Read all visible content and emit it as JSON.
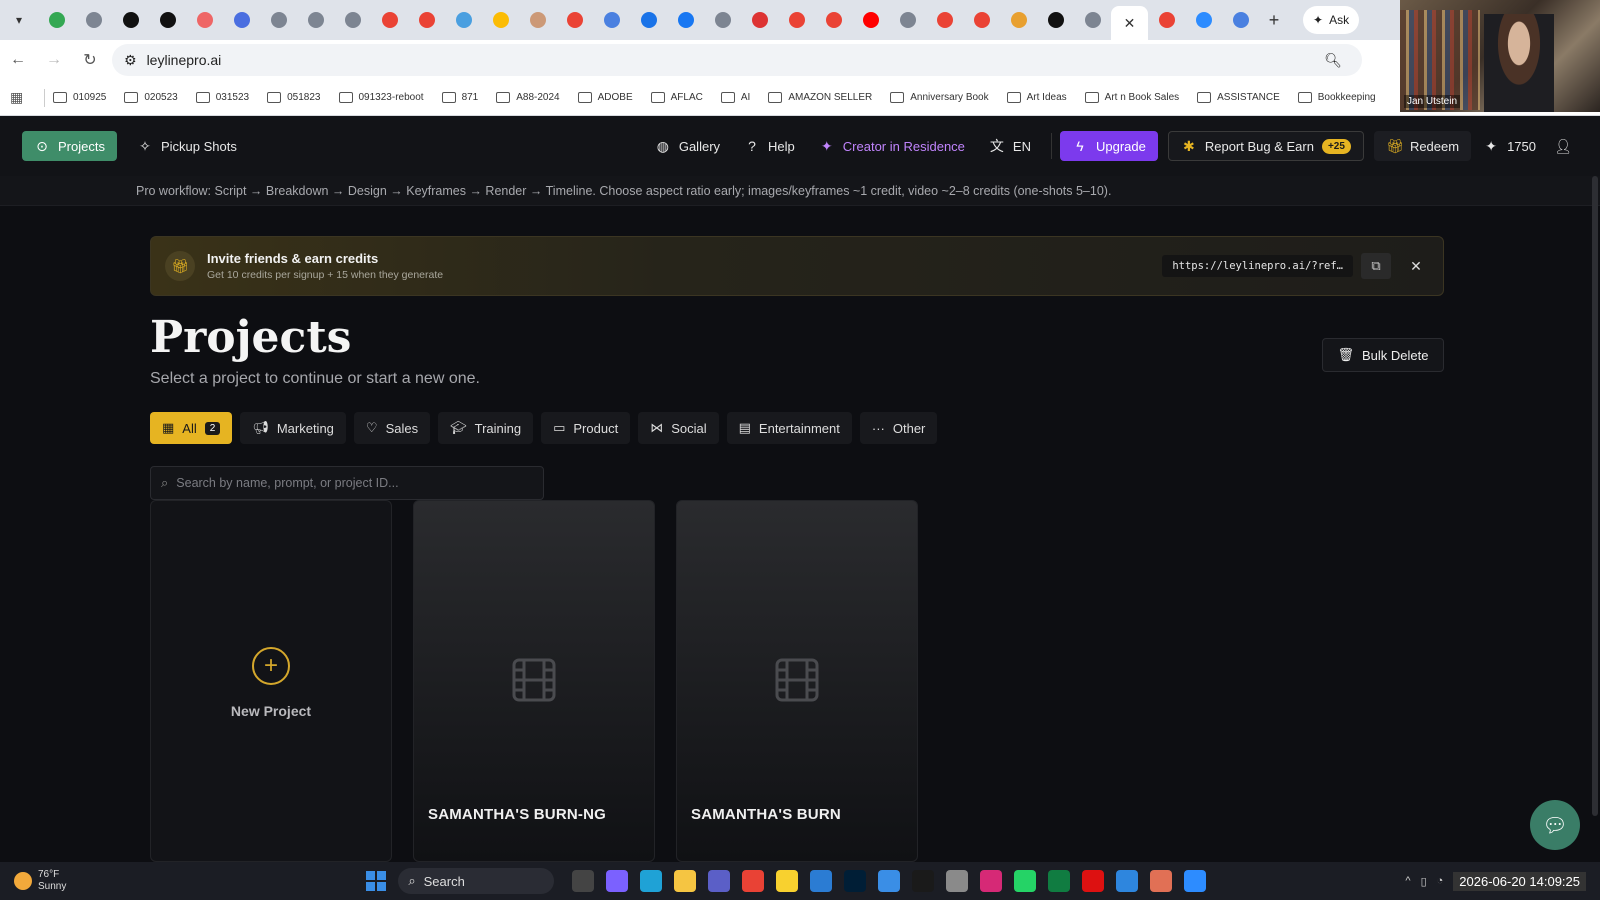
{
  "browser": {
    "active_tab_close": "✕",
    "new_tab": "+",
    "ask_label": "Ask",
    "url": "leylinepro.ai",
    "bookmarks": [
      "010925",
      "020523",
      "031523",
      "051823",
      "091323-reboot",
      "871",
      "A88-2024",
      "ADOBE",
      "AFLAC",
      "AI",
      "AMAZON SELLER",
      "Anniversary Book",
      "Art Ideas",
      "Art n Book Sales",
      "ASSISTANCE",
      "Bookkeeping"
    ]
  },
  "webcam": {
    "name": "Jan Utstein"
  },
  "header": {
    "projects": "Projects",
    "pickup_shots": "Pickup Shots",
    "gallery": "Gallery",
    "help": "Help",
    "creator": "Creator in Residence",
    "language": "EN",
    "upgrade": "Upgrade",
    "report_bug": "Report Bug & Earn",
    "report_bonus": "+25",
    "redeem": "Redeem",
    "credits": "1750"
  },
  "workflow_tip": "Pro workflow: Script → Breakdown → Design → Keyframes → Render → Timeline. Choose aspect ratio early; images/keyframes ~1 credit, video ~2–8 credits (one-shots 5–10).",
  "invite": {
    "title": "Invite friends & earn credits",
    "subtitle": "Get 10 credits per signup + 15 when they generate",
    "link": "https://leylinepro.ai/?ref…"
  },
  "main": {
    "title": "Projects",
    "subtitle": "Select a project to continue or start a new one.",
    "bulk_delete": "Bulk Delete",
    "filters": [
      {
        "label": "All",
        "count": "2"
      },
      {
        "label": "Marketing"
      },
      {
        "label": "Sales"
      },
      {
        "label": "Training"
      },
      {
        "label": "Product"
      },
      {
        "label": "Social"
      },
      {
        "label": "Entertainment"
      },
      {
        "label": "Other"
      }
    ],
    "search_placeholder": "Search by name, prompt, or project ID...",
    "new_project": "New Project",
    "projects": [
      {
        "title": "SAMANTHA'S BURN-NG"
      },
      {
        "title": "SAMANTHA'S BURN"
      }
    ]
  },
  "taskbar": {
    "temp": "76°F",
    "weather": "Sunny",
    "search": "Search",
    "clock": "2026-06-20 14:09:25"
  },
  "colors": {
    "accent_yellow": "#e6b422",
    "projects_green": "#3f8d69",
    "upgrade_purple": "#7c3aed",
    "creator_text": "#c084fc"
  }
}
